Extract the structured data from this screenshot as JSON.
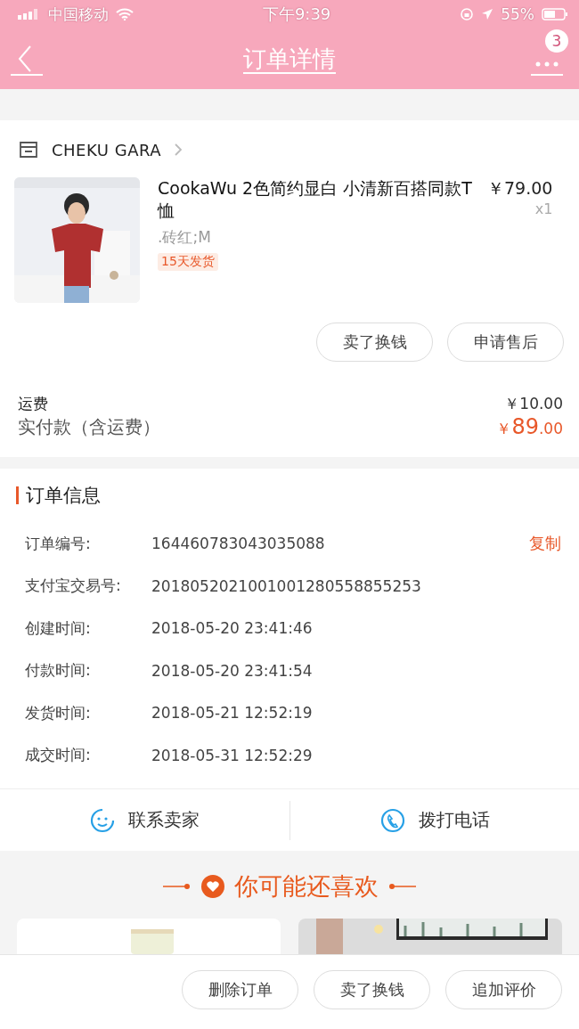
{
  "status_bar": {
    "carrier": "中国移动",
    "time": "下午9:39",
    "battery": "55%"
  },
  "nav": {
    "title": "订单详情",
    "badge": "3"
  },
  "shop": {
    "name": "CHEKU GARA"
  },
  "item": {
    "title": "CookaWu 2色简约显白 小清新百搭同款T恤",
    "price": "￥79.00",
    "quantity": "x1",
    "sku": ".砖红;M",
    "tag": "15天发货"
  },
  "item_buttons": [
    "卖了换钱",
    "申请售后"
  ],
  "fees": {
    "shipping_label": "运费",
    "shipping": "￥10.00",
    "paid_label": "实付款（含运费）",
    "paid_currency": "￥",
    "paid_int": "89",
    "paid_dec": ".00"
  },
  "order_info": {
    "title": "订单信息",
    "copy": "复制",
    "rows": [
      {
        "label": "订单编号:",
        "value": "164460783043035088"
      },
      {
        "label": "支付宝交易号:",
        "value": "2018052021001001280558855253"
      },
      {
        "label": "创建时间:",
        "value": "2018-05-20 23:41:46"
      },
      {
        "label": "付款时间:",
        "value": "2018-05-20 23:41:54"
      },
      {
        "label": "发货时间:",
        "value": "2018-05-21 12:52:19"
      },
      {
        "label": "成交时间:",
        "value": "2018-05-31 12:52:29"
      }
    ]
  },
  "contact": [
    "联系卖家",
    "拨打电话"
  ],
  "recommend": {
    "title": "你可能还喜欢"
  },
  "bottom_buttons": [
    "删除订单",
    "卖了换钱",
    "追加评价"
  ]
}
